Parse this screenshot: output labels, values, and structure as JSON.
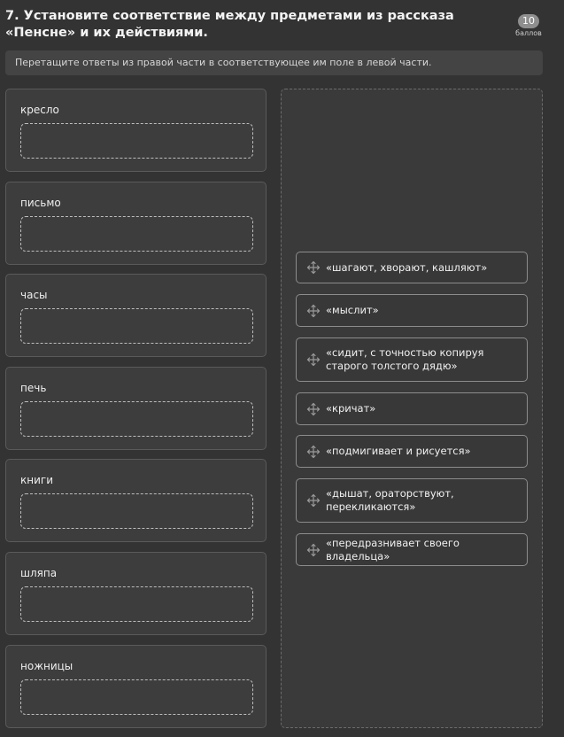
{
  "question": {
    "title": "7. Установите соответствие между предметами из рассказа «Пенсне» и их действиями.",
    "points_value": "10",
    "points_label": "баллов",
    "instruction": "Перетащите ответы из правой части в соответствующее им поле в левой части."
  },
  "targets": [
    {
      "label": "кресло"
    },
    {
      "label": "письмо"
    },
    {
      "label": "часы"
    },
    {
      "label": "печь"
    },
    {
      "label": "книги"
    },
    {
      "label": "шляпа"
    },
    {
      "label": "ножницы"
    }
  ],
  "answers": [
    {
      "text": "«шагают, хворают, кашляют»"
    },
    {
      "text": "«мыслит»"
    },
    {
      "text": "«сидит, с точностью копируя старого толстого дядю»"
    },
    {
      "text": "«кричат»"
    },
    {
      "text": "«подмигивает и рисуется»"
    },
    {
      "text": "«дышат, ораторствуют, перекликаются»"
    },
    {
      "text": "«передразнивает своего владельца»"
    }
  ],
  "icons": {
    "drag_handle": "move-arrows-icon"
  },
  "colors": {
    "background": "#333333",
    "card": "#3d3d3d",
    "answer_border": "#8c8c8c",
    "badge": "#8f8f8f"
  }
}
